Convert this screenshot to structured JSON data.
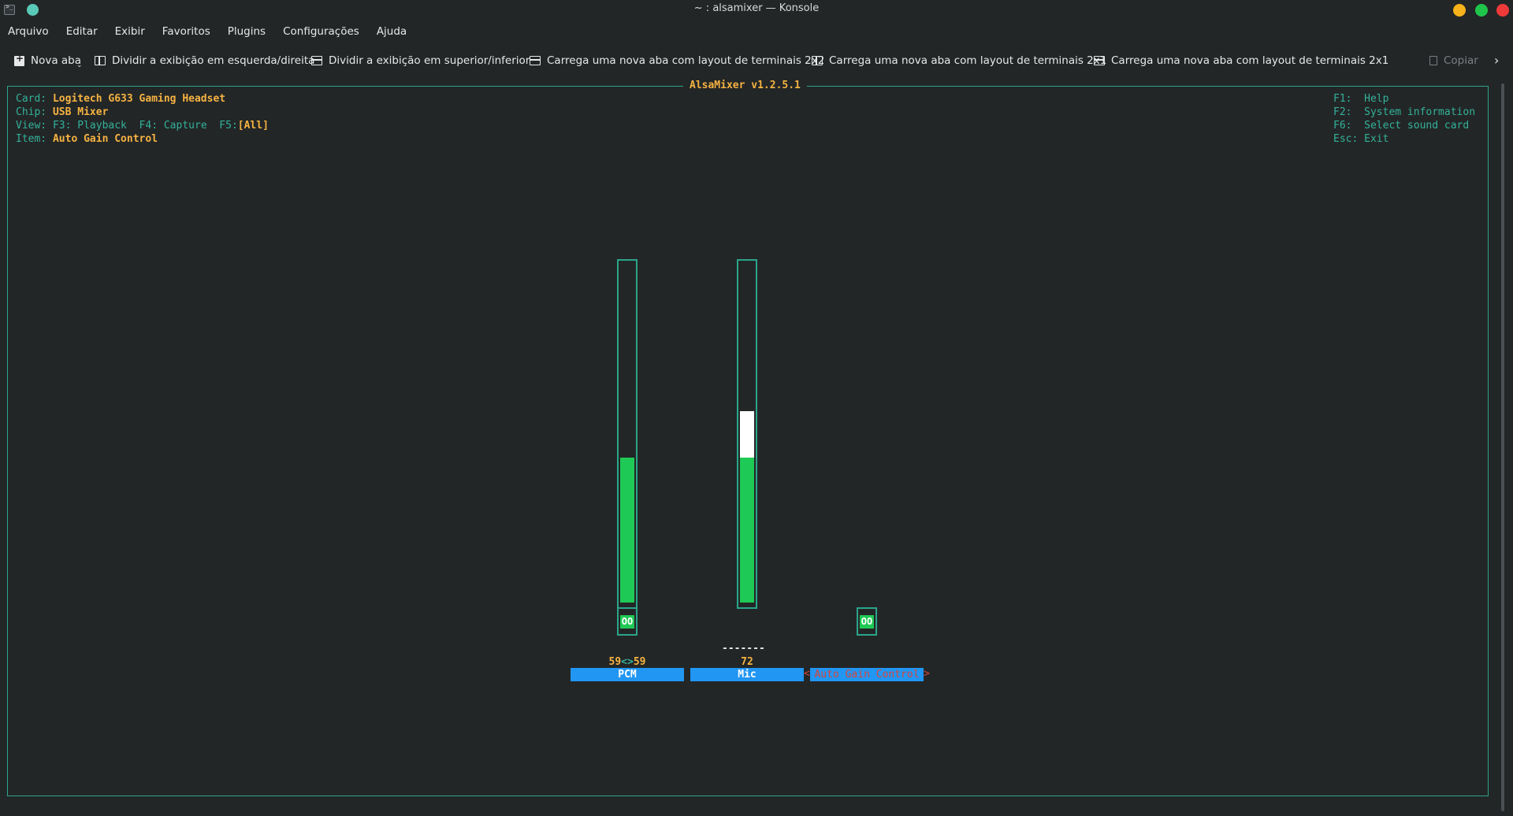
{
  "window": {
    "title": "~ : alsamixer — Konsole",
    "buttons": [
      {
        "name": "minimize",
        "color": "#f6b21a"
      },
      {
        "name": "maximize",
        "color": "#1fc44a"
      },
      {
        "name": "close",
        "color": "#ef3a3a"
      }
    ]
  },
  "menubar": {
    "items": [
      "Arquivo",
      "Editar",
      "Exibir",
      "Favoritos",
      "Plugins",
      "Configurações",
      "Ajuda"
    ]
  },
  "toolbar": {
    "new_tab": "Nova aba",
    "split_lr": "Dividir a exibição em esquerda/direita",
    "split_tb": "Dividir a exibição em superior/inferior",
    "layout_2x2": "Carrega uma nova aba com layout de terminais 2x2",
    "layout_2x1_a": "Carrega uma nova aba com layout de terminais 2x1",
    "layout_2x1_b": "Carrega uma nova aba com layout de terminais 2x1",
    "copy": "Copiar"
  },
  "alsamixer": {
    "title": "AlsaMixer v1.2.5.1",
    "card_label": "Card:",
    "card_value": "Logitech G633 Gaming Headset",
    "chip_label": "Chip:",
    "chip_value": "USB Mixer",
    "view_label": "View:",
    "view_f3": "F3: Playback",
    "view_f4": "F4: Capture",
    "view_f5_key": "F5:",
    "view_f5_value": "[All]",
    "item_label": "Item:",
    "item_value": "Auto Gain Control",
    "help": [
      {
        "key": "F1:",
        "text": "Help"
      },
      {
        "key": "F2:",
        "text": "System information"
      },
      {
        "key": "F6:",
        "text": "Select sound card"
      },
      {
        "key": "Esc:",
        "text": "Exit"
      }
    ],
    "controls": [
      {
        "name": "PCM",
        "value_left": "59",
        "value_right": "59",
        "arrows": "<>",
        "level": 0.59,
        "mute": "OO"
      },
      {
        "name": "Mic",
        "value": "72",
        "capture": "-------",
        "level": 0.72
      },
      {
        "name": "Auto Gain Control",
        "mute": "OO",
        "selected": true
      }
    ]
  }
}
